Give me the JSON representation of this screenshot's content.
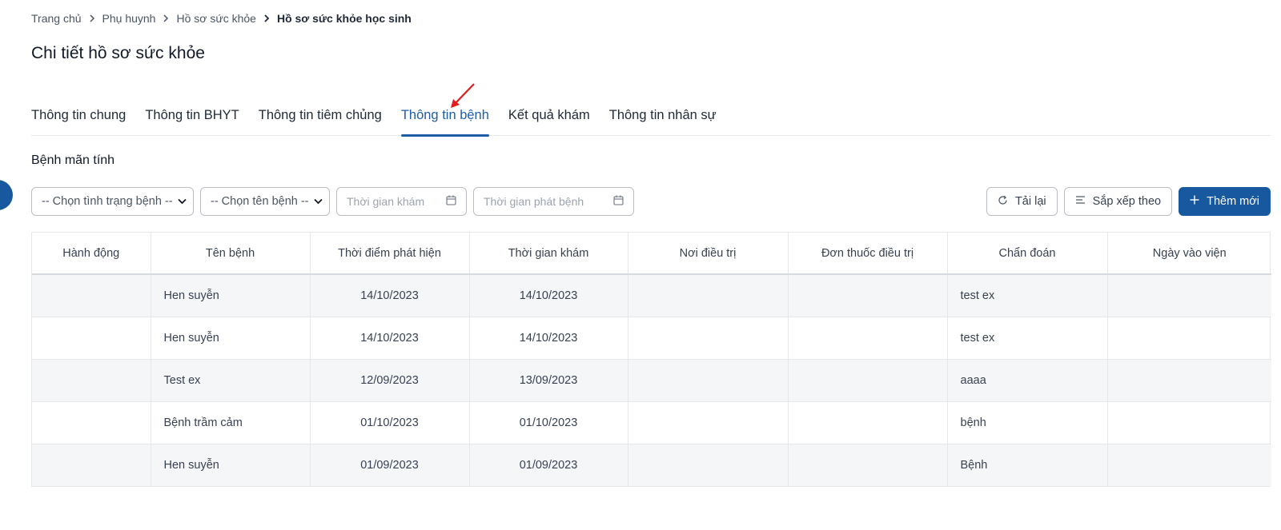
{
  "breadcrumb": {
    "items": [
      "Trang chủ",
      "Phụ huynh",
      "Hồ sơ sức khỏe"
    ],
    "current": "Hồ sơ sức khỏe học sinh"
  },
  "page_title": "Chi tiết hồ sơ sức khỏe",
  "tabs": [
    {
      "label": "Thông tin chung",
      "active": false
    },
    {
      "label": "Thông tin BHYT",
      "active": false
    },
    {
      "label": "Thông tin tiêm chủng",
      "active": false
    },
    {
      "label": "Thông tin bệnh",
      "active": true
    },
    {
      "label": "Kết quả khám",
      "active": false
    },
    {
      "label": "Thông tin nhân sự",
      "active": false
    }
  ],
  "section_title": "Bệnh mãn tính",
  "filters": {
    "status_select": "-- Chọn tình trạng bệnh --",
    "disease_select": "-- Chọn tên bệnh --",
    "exam_time_placeholder": "Thời gian khám",
    "onset_time_placeholder": "Thời gian phát bệnh"
  },
  "actions": {
    "reload_label": "Tải lại",
    "sort_label": "Sắp xếp theo",
    "add_label": "Thêm mới"
  },
  "table": {
    "columns": [
      "Hành động",
      "Tên bệnh",
      "Thời điểm phát hiện",
      "Thời gian khám",
      "Nơi điều trị",
      "Đơn thuốc điều trị",
      "Chẩn đoán",
      "Ngày vào viện"
    ],
    "rows": [
      [
        "",
        "Hen suyễn",
        "14/10/2023",
        "14/10/2023",
        "",
        "",
        "test ex",
        ""
      ],
      [
        "",
        "Hen suyễn",
        "14/10/2023",
        "14/10/2023",
        "",
        "",
        "test ex",
        ""
      ],
      [
        "",
        "Test ex",
        "12/09/2023",
        "13/09/2023",
        "",
        "",
        "aaaa",
        ""
      ],
      [
        "",
        "Bệnh trầm cảm",
        "01/10/2023",
        "01/10/2023",
        "",
        "",
        "bệnh",
        ""
      ],
      [
        "",
        "Hen suyễn",
        "01/09/2023",
        "01/09/2023",
        "",
        "",
        "Bệnh",
        ""
      ]
    ]
  },
  "colors": {
    "primary": "#17589f",
    "active_tab": "#1f5ca8",
    "annotation_arrow": "#e11d1d"
  }
}
